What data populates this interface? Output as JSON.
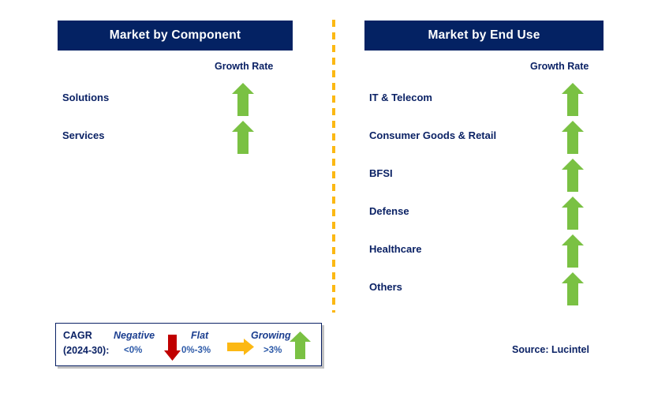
{
  "colors": {
    "header_bg": "#042263",
    "header_text": "#ffffff",
    "label_navy": "#0b2265",
    "growth_green": "#7ac143",
    "negative_red": "#c00000",
    "flat_amber": "#fcb813",
    "divider_amber": "#fcb813",
    "legend_border": "#0b2265"
  },
  "panels": [
    {
      "id": "component",
      "title": "Market by Component",
      "growth_rate_label": "Growth Rate",
      "rows": [
        {
          "label": "Solutions",
          "growth": "growing",
          "icon": "arrow-up-green-icon"
        },
        {
          "label": "Services",
          "growth": "growing",
          "icon": "arrow-up-green-icon"
        }
      ]
    },
    {
      "id": "end_use",
      "title": "Market by End Use",
      "growth_rate_label": "Growth Rate",
      "rows": [
        {
          "label": "IT & Telecom",
          "growth": "growing",
          "icon": "arrow-up-green-icon"
        },
        {
          "label": "Consumer Goods & Retail",
          "growth": "growing",
          "icon": "arrow-up-green-icon"
        },
        {
          "label": "BFSI",
          "growth": "growing",
          "icon": "arrow-up-green-icon"
        },
        {
          "label": "Defense",
          "growth": "growing",
          "icon": "arrow-up-green-icon"
        },
        {
          "label": "Healthcare",
          "growth": "growing",
          "icon": "arrow-up-green-icon"
        },
        {
          "label": "Others",
          "growth": "growing",
          "icon": "arrow-up-green-icon"
        }
      ]
    }
  ],
  "legend": {
    "title_line1": "CAGR",
    "title_line2": "(2024-30):",
    "entries": [
      {
        "term": "Negative",
        "range": "<0%",
        "icon": "arrow-down-red-icon"
      },
      {
        "term": "Flat",
        "range": "0%-3%",
        "icon": "arrow-right-amber-icon"
      },
      {
        "term": "Growing",
        "range": ">3%",
        "icon": "arrow-up-green-icon"
      }
    ]
  },
  "source": "Source: Lucintel",
  "chart_data": {
    "type": "table",
    "title": "Market Growth Rate by Segment",
    "categories": [
      "Market by Component",
      "Market by End Use"
    ],
    "series": [
      {
        "name": "Market by Component",
        "items": [
          {
            "label": "Solutions",
            "growth_rate": "Growing",
            "cagr_band": ">3%"
          },
          {
            "label": "Services",
            "growth_rate": "Growing",
            "cagr_band": ">3%"
          }
        ]
      },
      {
        "name": "Market by End Use",
        "items": [
          {
            "label": "IT & Telecom",
            "growth_rate": "Growing",
            "cagr_band": ">3%"
          },
          {
            "label": "Consumer Goods & Retail",
            "growth_rate": "Growing",
            "cagr_band": ">3%"
          },
          {
            "label": "BFSI",
            "growth_rate": "Growing",
            "cagr_band": ">3%"
          },
          {
            "label": "Defense",
            "growth_rate": "Growing",
            "cagr_band": ">3%"
          },
          {
            "label": "Healthcare",
            "growth_rate": "Growing",
            "cagr_band": ">3%"
          },
          {
            "label": "Others",
            "growth_rate": "Growing",
            "cagr_band": ">3%"
          }
        ]
      }
    ],
    "legend_entries": [
      {
        "name": "Negative",
        "range": "<0%",
        "color": "#c00000",
        "direction": "down"
      },
      {
        "name": "Flat",
        "range": "0%-3%",
        "color": "#fcb813",
        "direction": "right"
      },
      {
        "name": "Growing",
        "range": ">3%",
        "color": "#7ac143",
        "direction": "up"
      }
    ],
    "xlabel": "",
    "ylabel": "Growth Rate",
    "grid": false,
    "legend_position": "bottom-left"
  }
}
